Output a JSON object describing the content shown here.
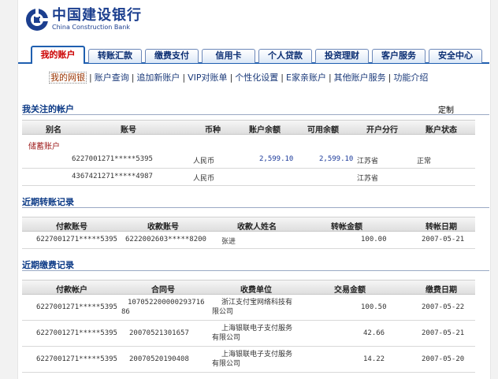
{
  "header": {
    "bank_name_cn": "中国建设银行",
    "bank_name_en": "China Construction Bank"
  },
  "tabs": [
    {
      "label": "我的账户",
      "active": true
    },
    {
      "label": "转账汇款"
    },
    {
      "label": "缴费支付"
    },
    {
      "label": "信用卡"
    },
    {
      "label": "个人贷款"
    },
    {
      "label": "投资理财"
    },
    {
      "label": "客户服务"
    },
    {
      "label": "安全中心"
    }
  ],
  "subnav": [
    {
      "label": "我的网银",
      "current": true
    },
    {
      "label": "账户查询"
    },
    {
      "label": "追加新账户"
    },
    {
      "label": "VIP对账单"
    },
    {
      "label": "个性化设置"
    },
    {
      "label": "E家亲账户"
    },
    {
      "label": "其他账户服务"
    },
    {
      "label": "功能介绍"
    }
  ],
  "watched": {
    "title": "我关注的帐户",
    "custom_label": "定制",
    "headers": [
      "别名",
      "账号",
      "币种",
      "账户余额",
      "可用余额",
      "开户分行",
      "账户状态"
    ],
    "category": "储蓄账户",
    "rows": [
      {
        "account": "6227001271*****5395",
        "currency": "人民币",
        "balance": "2,599.10",
        "available": "2,599.10",
        "branch": "江苏省",
        "status": "正常"
      },
      {
        "account": "4367421271*****4987",
        "currency": "人民币",
        "balance": "",
        "available": "",
        "branch": "江苏省",
        "status": ""
      }
    ]
  },
  "transfers": {
    "title": "近期转账记录",
    "headers": [
      "付款账号",
      "收款账号",
      "收款人姓名",
      "转帐金额",
      "转帐日期"
    ],
    "rows": [
      {
        "from": "6227001271*****5395",
        "to": "6222002603*****8200",
        "name": "张进",
        "amount": "100.00",
        "date": "2007-05-21"
      }
    ]
  },
  "payments": {
    "title": "近期缴费记录",
    "headers": [
      "付款帐户",
      "合同号",
      "收费单位",
      "交易金额",
      "缴费日期"
    ],
    "rows": [
      {
        "from": "6227001271*****5395",
        "contract": "10705220000029371686",
        "unit": "浙江支付宝网络科技有限公司",
        "amount": "100.50",
        "date": "2007-05-22"
      },
      {
        "from": "6227001271*****5395",
        "contract": "20070521301657",
        "unit": "上海银联电子支付服务有限公司",
        "amount": "42.66",
        "date": "2007-05-21"
      },
      {
        "from": "6227001271*****5395",
        "contract": "20070520190408",
        "unit": "上海银联电子支付服务有限公司",
        "amount": "14.22",
        "date": "2007-05-20"
      }
    ]
  }
}
